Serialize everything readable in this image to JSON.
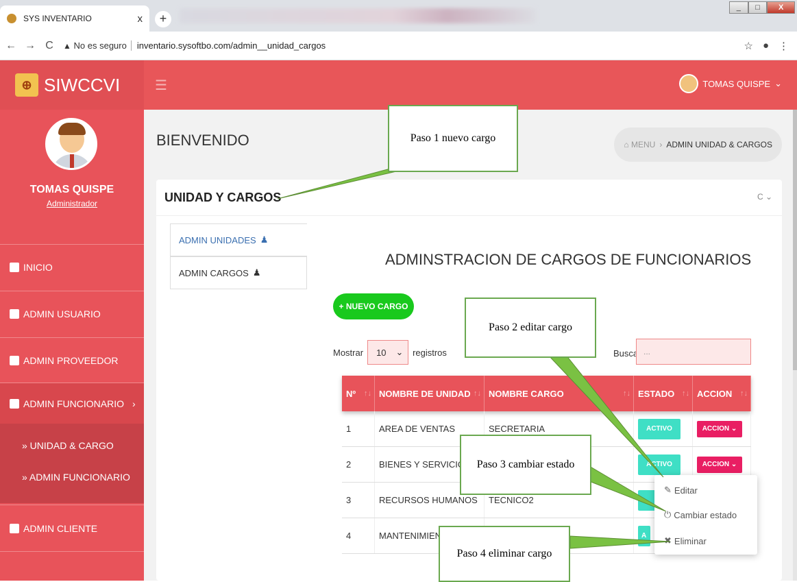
{
  "browser": {
    "tab_title": "SYS INVENTARIO",
    "tab_close": "x",
    "new_tab": "+",
    "back": "←",
    "forward": "→",
    "reload": "C",
    "security_warning": "No es seguro",
    "url": "inventario.sysoftbo.com/admin__unidad_cargos",
    "window_controls": [
      "_",
      "□",
      "X"
    ]
  },
  "header": {
    "brand": "SIWCCVI",
    "menu_toggle": "☰",
    "user_name": "TOMAS QUISPE",
    "user_caret": "⌄"
  },
  "sidebar": {
    "name": "TOMAS QUISPE",
    "role": "Administrador",
    "items": [
      {
        "label": "INICIO"
      },
      {
        "label": "ADMIN USUARIO"
      },
      {
        "label": "ADMIN PROVEEDOR"
      },
      {
        "label": "ADMIN FUNCIONARIO",
        "caret": "›"
      },
      {
        "label": "ADMIN CLIENTE"
      }
    ],
    "subitems": [
      {
        "label": "» UNIDAD & CARGO"
      },
      {
        "label": "» ADMIN FUNCIONARIO"
      }
    ]
  },
  "main": {
    "page_title": "BIENVENIDO",
    "breadcrumb": {
      "root": "MENU",
      "sep": "›",
      "current": "ADMIN UNIDAD & CARGOS"
    },
    "card_title": "UNIDAD Y CARGOS",
    "card_tools": "C ⌄",
    "tabs": [
      {
        "label": "ADMIN UNIDADES"
      },
      {
        "label": "ADMIN CARGOS"
      }
    ],
    "section_title": "ADMINSTRACION DE CARGOS DE FUNCIONARIOS",
    "new_button": "+ NUEVO CARGO",
    "show_label": "Mostrar",
    "show_value": "10",
    "records_label": "registros",
    "search_label": "Buscar:",
    "search_placeholder": "...",
    "table": {
      "headers": [
        "Nº",
        "NOMBRE DE UNIDAD",
        "NOMBRE CARGO",
        "ESTADO",
        "ACCION"
      ],
      "rows": [
        {
          "n": "1",
          "unidad": "AREA DE VENTAS",
          "cargo": "SECRETARIA",
          "estado": "ACTIVO",
          "accion": "ACCION ⌄"
        },
        {
          "n": "2",
          "unidad": "BIENES Y SERVICIO",
          "cargo": "",
          "estado": "ACTIVO",
          "accion": "ACCION ⌄"
        },
        {
          "n": "3",
          "unidad": "RECURSOS HUMANOS",
          "cargo": "TECNICO2",
          "estado": "",
          "accion": ""
        },
        {
          "n": "4",
          "unidad": "MANTENIMIEN",
          "cargo": "",
          "estado": "A",
          "accion": ""
        }
      ]
    },
    "dropdown": [
      {
        "icon": "✎",
        "label": "Editar"
      },
      {
        "icon": "⏻",
        "label": "Cambiar estado"
      },
      {
        "icon": "✖",
        "label": "Eliminar"
      }
    ]
  },
  "callouts": {
    "paso1": "Paso 1 nuevo cargo",
    "paso2": "Paso 2 editar cargo",
    "paso3": "Paso 3 cambiar estado",
    "paso4": "Paso 4 eliminar cargo"
  },
  "colors": {
    "header": "#e85659",
    "sidebar": "#e8535a",
    "new_button": "#19c91d",
    "active_badge": "#3fdfc5",
    "action_button": "#e91e63",
    "callout_border": "#6aa84f"
  }
}
